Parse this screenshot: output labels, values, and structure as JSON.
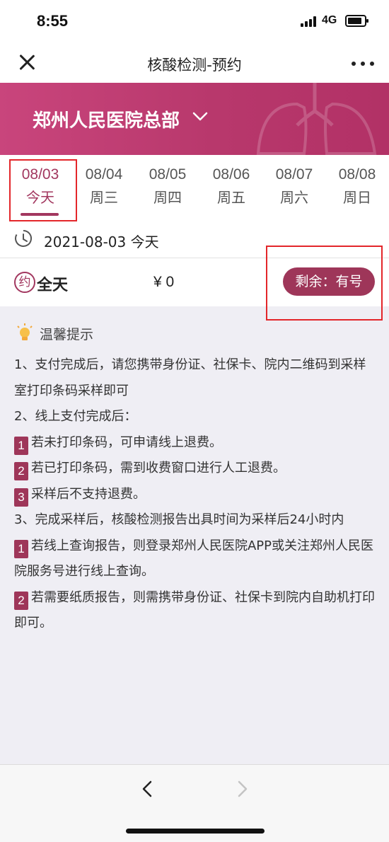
{
  "status_bar": {
    "time": "8:55",
    "network": "4G"
  },
  "nav": {
    "title": "核酸检测-预约"
  },
  "hospital": {
    "name": "郑州人民医院总部"
  },
  "date_tabs": [
    {
      "date": "08/03",
      "weekday": "今天",
      "active": true
    },
    {
      "date": "08/04",
      "weekday": "周三",
      "active": false
    },
    {
      "date": "08/05",
      "weekday": "周四",
      "active": false
    },
    {
      "date": "08/06",
      "weekday": "周五",
      "active": false
    },
    {
      "date": "08/07",
      "weekday": "周六",
      "active": false
    },
    {
      "date": "08/08",
      "weekday": "周日",
      "active": false
    }
  ],
  "selected_date": "2021-08-03 今天",
  "slot": {
    "icon_char": "约",
    "name": "全天",
    "price": "¥ 0",
    "remaining": "剩余：有号"
  },
  "tips": {
    "title": "温馨提示",
    "lines": {
      "l1": "1、支付完成后，请您携带身份证、社保卡、院内二维码到采样室打印条码采样即可",
      "l2": "2、线上支付完成后：",
      "l2_1_num": "1",
      "l2_1": "若未打印条码，可申请线上退费。",
      "l2_2_num": "2",
      "l2_2": "若已打印条码，需到收费窗口进行人工退费。",
      "l2_3_num": "3",
      "l2_3": "采样后不支持退费。",
      "l3": "3、完成采样后，核酸检测报告出具时间为采样后24小时内",
      "l3_1_num": "1",
      "l3_1": "若线上查询报告，则登录郑州人民医院APP或关注郑州人民医院服务号进行线上查询。",
      "l3_2_num": "2",
      "l3_2": "若需要纸质报告，则需携带身份证、社保卡到院内自助机打印即可。"
    }
  },
  "colors": {
    "accent": "#a2375f",
    "banner": "#c9457c",
    "highlight_box": "#e3262a"
  },
  "icons": [
    "close-icon",
    "more-icon",
    "chevron-down-icon",
    "clock-icon",
    "lightbulb-icon",
    "back-arrow-icon",
    "forward-arrow-icon"
  ]
}
